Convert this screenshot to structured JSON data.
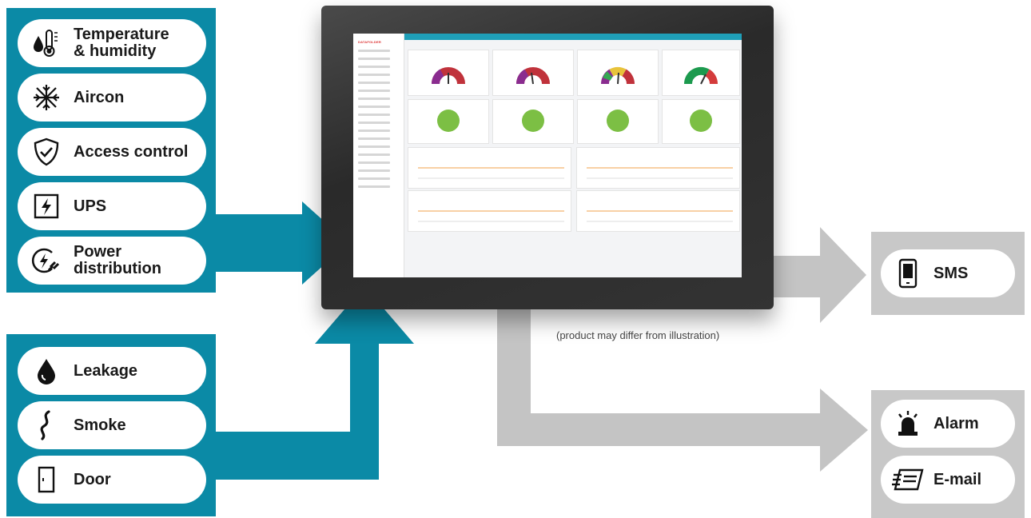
{
  "inputs_top": [
    {
      "icon": "thermometer-drop-icon",
      "label": "Temperature\n& humidity"
    },
    {
      "icon": "snowflake-icon",
      "label": "Aircon"
    },
    {
      "icon": "shield-check-icon",
      "label": "Access control"
    },
    {
      "icon": "lightning-box-icon",
      "label": "UPS"
    },
    {
      "icon": "power-plug-icon",
      "label": "Power\ndistribution"
    }
  ],
  "inputs_bottom": [
    {
      "icon": "water-drop-icon",
      "label": "Leakage"
    },
    {
      "icon": "smoke-icon",
      "label": "Smoke"
    },
    {
      "icon": "door-icon",
      "label": "Door"
    }
  ],
  "outputs": [
    {
      "icon": "phone-icon",
      "label": "SMS"
    },
    {
      "icon": "alarm-beacon-icon",
      "label": "Alarm"
    },
    {
      "icon": "email-icon",
      "label": "E-mail"
    }
  ],
  "screen": {
    "logo": "DATAFOLDER"
  },
  "caption": "(product may differ from illustration)",
  "colors": {
    "teal": "#0b8aa6",
    "grey": "#c8c8c8"
  }
}
